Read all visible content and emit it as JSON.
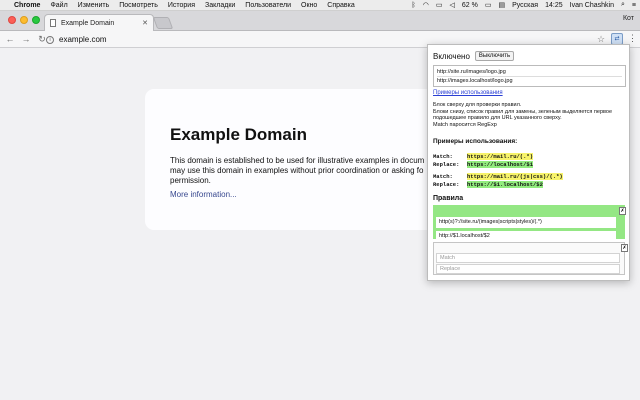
{
  "menubar": {
    "items": [
      "Chrome",
      "Файл",
      "Изменить",
      "Посмотреть",
      "История",
      "Закладки",
      "Пользователи",
      "Окно",
      "Справка"
    ],
    "battery": "62 %",
    "language": "Русская",
    "time": "14:25",
    "user": "Ivan Chashkin"
  },
  "browser": {
    "tab_title": "Example Domain",
    "profile": "Кот",
    "url": "example.com"
  },
  "page": {
    "heading": "Example Domain",
    "paragraph": "This domain is established to be used for illustrative examples in docum may use this domain in examples without prior coordination or asking fo permission.",
    "link": "More information..."
  },
  "popup": {
    "enabled_label": "Включено",
    "toggle_label": "Выключить",
    "test_url_1": "http://site.ru/images/logo.jpg",
    "test_url_2": "http://images.localhost/logo.jpg",
    "examples_link": "Примеры использования",
    "desc_1": "Блок сверху для проверки правил.",
    "desc_2": "Блоки снизу, список правил для замены, зеленым выделяется первое подошедшее правило для URL указанного сверху.",
    "desc_3": "Match паросится RegExp",
    "examples_heading": "Примеры использования:",
    "match_label": "Match:",
    "replace_label": "Replace:",
    "ex1_match": "https://mail.ru/(.*)",
    "ex1_replace": "https://localhost/$1",
    "ex2_match": "https://mail.ru/(js|css)/(.*)",
    "ex2_replace": "https://$1.localhost/$2",
    "rules_heading": "Правила",
    "rule_match": "http(s)?://site.ru/(images|scripts|styles)/(.*)",
    "rule_replace": "http://$1.localhost/$2",
    "new_match_placeholder": "Match",
    "new_replace_placeholder": "Replace",
    "close_glyph": "✗",
    "active_rule_color": "#94e784"
  }
}
